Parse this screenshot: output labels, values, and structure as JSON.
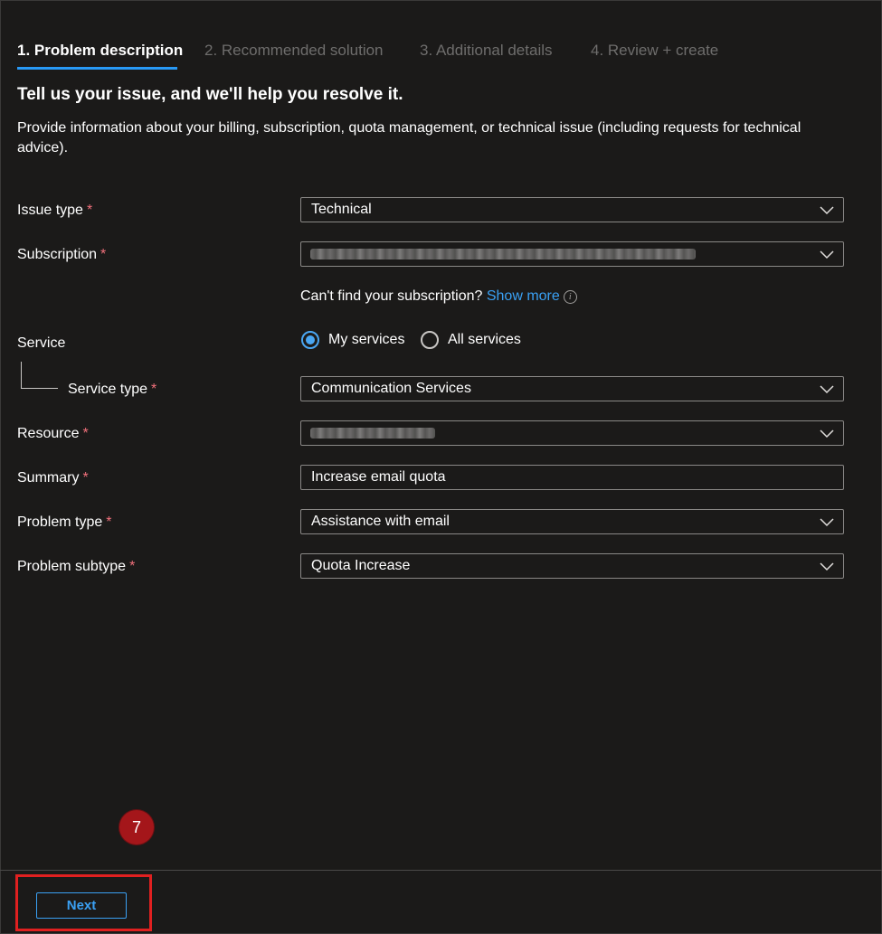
{
  "tabs": [
    {
      "label": "1. Problem description",
      "active": true
    },
    {
      "label": "2. Recommended solution",
      "active": false
    },
    {
      "label": "3. Additional details",
      "active": false
    },
    {
      "label": "4. Review + create",
      "active": false
    }
  ],
  "heading": "Tell us your issue, and we'll help you resolve it.",
  "description": "Provide information about your billing, subscription, quota management, or technical issue (including requests for technical advice).",
  "required_marker": "*",
  "fields": {
    "issue_type": {
      "label": "Issue type",
      "value": "Technical"
    },
    "subscription": {
      "label": "Subscription",
      "value": ""
    },
    "service": {
      "label": "Service"
    },
    "service_type": {
      "label": "Service type",
      "value": "Communication Services"
    },
    "resource": {
      "label": "Resource",
      "value": ""
    },
    "summary": {
      "label": "Summary",
      "value": "Increase email quota"
    },
    "problem_type": {
      "label": "Problem type",
      "value": "Assistance with email"
    },
    "problem_subtype": {
      "label": "Problem subtype",
      "value": "Quota Increase"
    }
  },
  "cant_find": {
    "text": "Can't find your subscription?",
    "link": "Show more",
    "info_icon": "i"
  },
  "service_options": [
    {
      "label": "My services",
      "selected": true
    },
    {
      "label": "All services",
      "selected": false
    }
  ],
  "step_badge": "7",
  "next_button": "Next",
  "colors": {
    "accent": "#3aa0f3",
    "required": "#f1707b",
    "highlight": "#e02020",
    "badge": "#a4161a"
  }
}
